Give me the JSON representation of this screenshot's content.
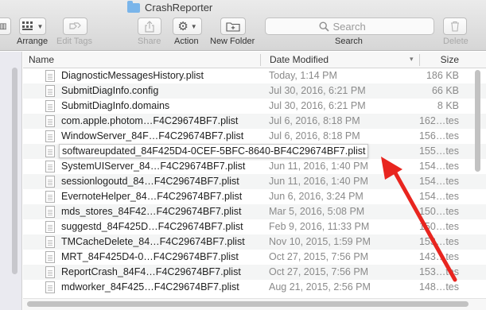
{
  "window": {
    "title": "CrashReporter"
  },
  "toolbar": {
    "arrange_label": "Arrange",
    "edit_tags_label": "Edit Tags",
    "share_label": "Share",
    "action_label": "Action",
    "new_folder_label": "New Folder",
    "search_label": "Search",
    "search_placeholder": "Search",
    "delete_label": "Delete"
  },
  "columns": {
    "name": "Name",
    "date": "Date Modified",
    "size": "Size"
  },
  "files": [
    {
      "name": "DiagnosticMessagesHistory.plist",
      "date": "Today, 1:14 PM",
      "size": "186 KB"
    },
    {
      "name": "SubmitDiagInfo.config",
      "date": "Jul 30, 2016, 6:21 PM",
      "size": "66 KB"
    },
    {
      "name": "SubmitDiagInfo.domains",
      "date": "Jul 30, 2016, 6:21 PM",
      "size": "8 KB"
    },
    {
      "name": "com.apple.photom…F4C29674BF7.plist",
      "date": "Jul 6, 2016, 8:18 PM",
      "size": "162…tes"
    },
    {
      "name": "WindowServer_84F…F4C29674BF7.plist",
      "date": "Jul 6, 2016, 8:18 PM",
      "size": "156…tes"
    },
    {
      "name": "softwareupdated_84F425D4-0CEF-5BFC-8640-BF4C29674BF7.plist",
      "date": "",
      "size": "155…tes"
    },
    {
      "name": "SystemUIServer_84…F4C29674BF7.plist",
      "date": "Jun 11, 2016, 1:40 PM",
      "size": "154…tes"
    },
    {
      "name": "sessionlogoutd_84…F4C29674BF7.plist",
      "date": "Jun 11, 2016, 1:40 PM",
      "size": "154…tes"
    },
    {
      "name": "EvernoteHelper_84…F4C29674BF7.plist",
      "date": "Jun 6, 2016, 3:24 PM",
      "size": "154…tes"
    },
    {
      "name": "mds_stores_84F42…F4C29674BF7.plist",
      "date": "Mar 5, 2016, 5:08 PM",
      "size": "150…tes"
    },
    {
      "name": "suggestd_84F425D…F4C29674BF7.plist",
      "date": "Feb 9, 2016, 11:33 PM",
      "size": "150…tes"
    },
    {
      "name": "TMCacheDelete_84…F4C29674BF7.plist",
      "date": "Nov 10, 2015, 1:59 PM",
      "size": "153…tes"
    },
    {
      "name": "MRT_84F425D4-0…F4C29674BF7.plist",
      "date": "Oct 27, 2015, 7:56 PM",
      "size": "143…tes"
    },
    {
      "name": "ReportCrash_84F4…F4C29674BF7.plist",
      "date": "Oct 27, 2015, 7:56 PM",
      "size": "153…tes"
    },
    {
      "name": "mdworker_84F425…F4C29674BF7.plist",
      "date": "Aug 21, 2015, 2:56 PM",
      "size": "148…tes"
    }
  ],
  "annotation": {
    "color": "#e8251f"
  }
}
